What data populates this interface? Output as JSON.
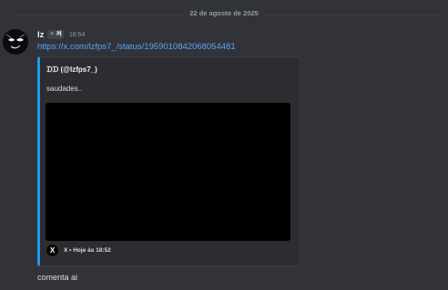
{
  "date_divider": "22 de agosto de 2025",
  "message": {
    "username": "lz",
    "tag_icon": "sparkle-icon",
    "tag_text": "켜",
    "time": "18:54",
    "link": "https://x.com/lzfps7_/status/1959010842068054481",
    "text": "comenta ai"
  },
  "embed": {
    "accent_color": "#1d9bf0",
    "author": "ᗪᗪ (@lzfps7_)",
    "description": "saudades..",
    "footer": "X • Hoje às 18:52",
    "footer_icon_glyph": "X"
  },
  "colors": {
    "background": "#323339",
    "link": "#5aa6f5"
  }
}
